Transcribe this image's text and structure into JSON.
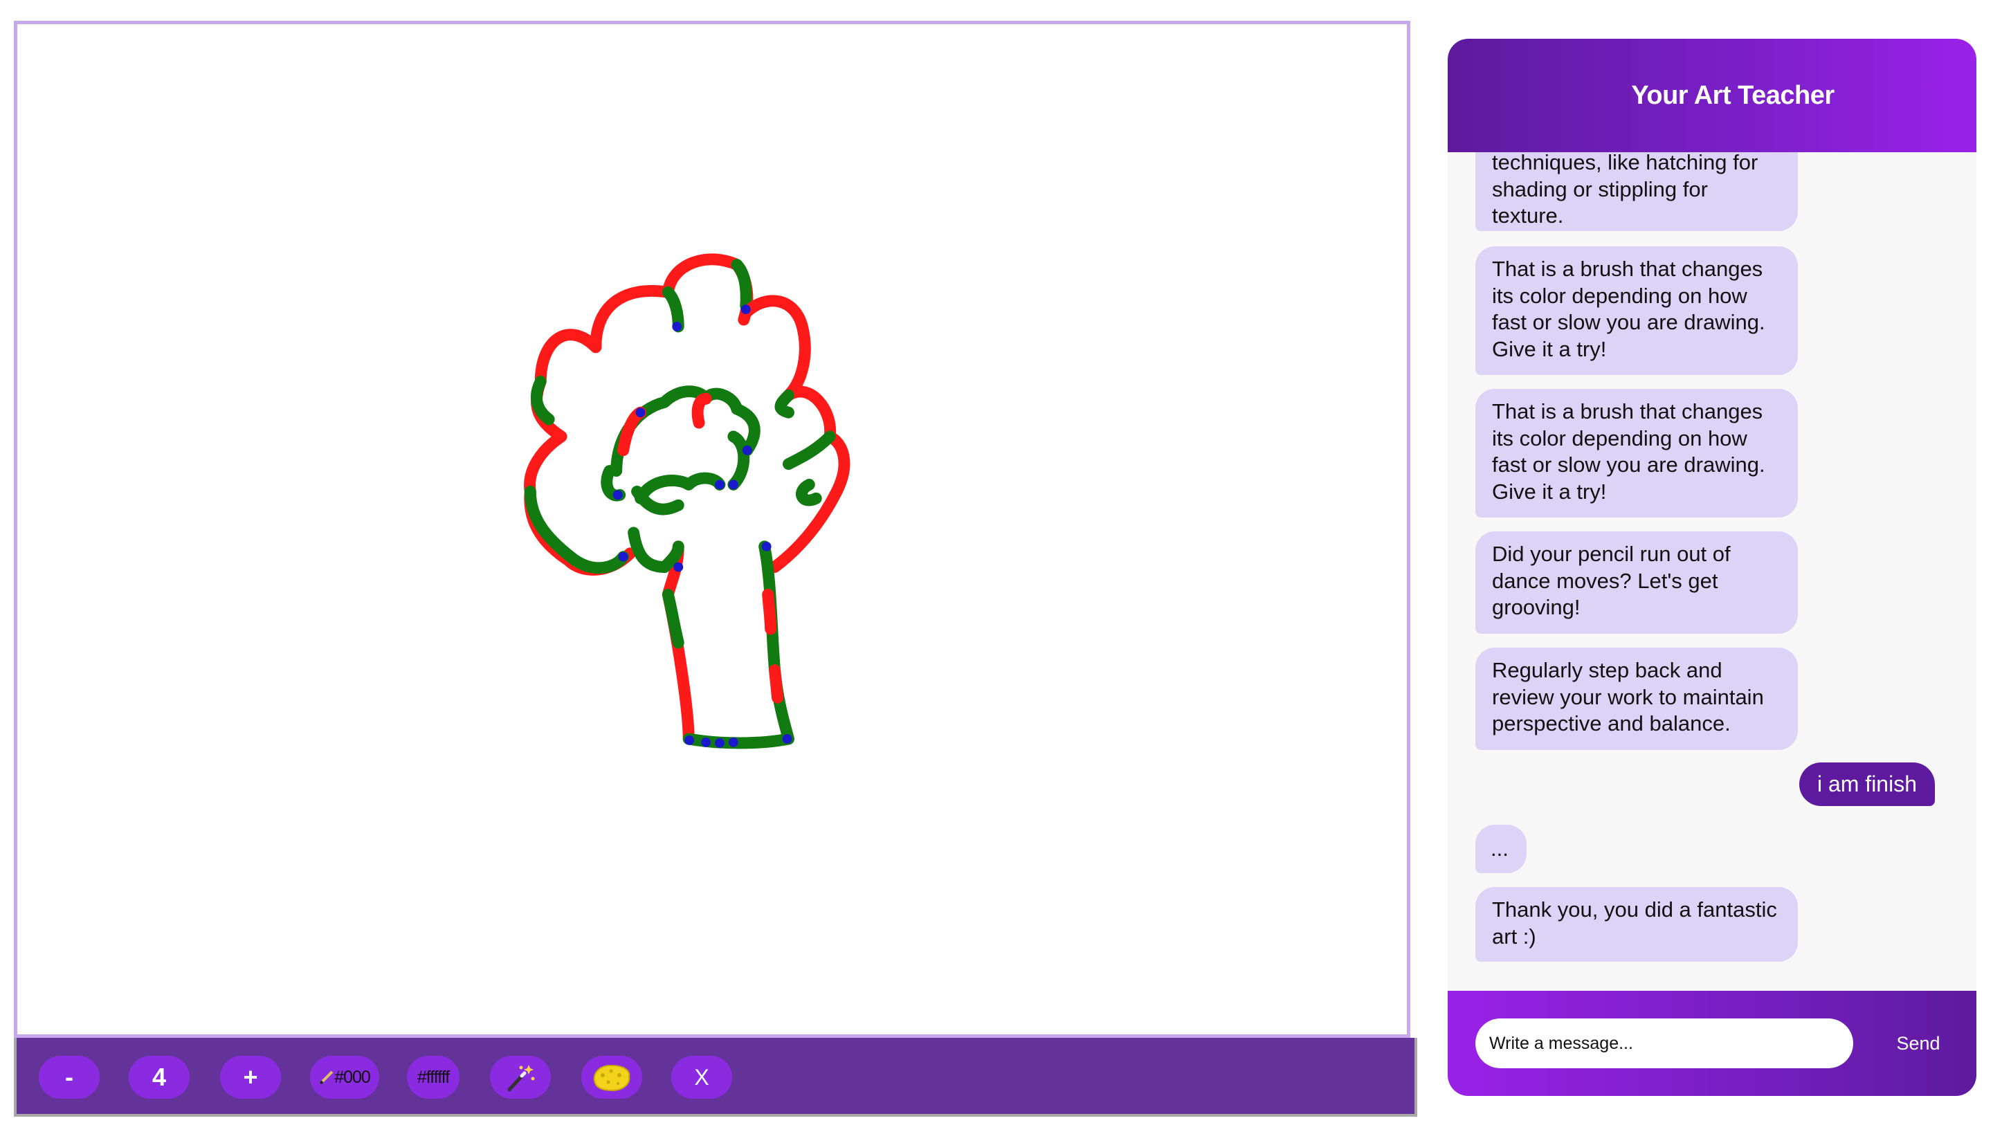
{
  "colors": {
    "toolbar_bg": "#643399",
    "button_bg": "#8a2be2",
    "canvas_border": "#c8a8ec",
    "bot_bubble": "#ddd3f7",
    "user_bubble": "#5e1a9e",
    "stroke_red": "#ff1a1a",
    "stroke_green": "#117a11",
    "stroke_blue": "#1a1acc"
  },
  "toolbar": {
    "decrease_label": "-",
    "brush_size": "4",
    "increase_label": "+",
    "stroke_color_label": "#000",
    "stroke_color_icon": "pencil-icon",
    "background_color_label": "#ffffff",
    "magic_brush_icon": "magic-wand-icon",
    "eraser_icon": "sponge-icon",
    "clear_label": "X"
  },
  "chat": {
    "title": "Your Art Teacher",
    "messages": [
      {
        "from": "bot",
        "text": "techniques, like hatching for shading or stippling for texture."
      },
      {
        "from": "bot",
        "text": "That is a brush that changes its color depending on how fast or slow you are drawing. Give it a try!"
      },
      {
        "from": "bot",
        "text": "That is a brush that changes its color depending on how fast or slow you are drawing. Give it a try!"
      },
      {
        "from": "bot",
        "text": "Did your pencil run out of dance moves? Let's get grooving!"
      },
      {
        "from": "bot",
        "text": "Regularly step back and review your work to maintain perspective and balance."
      },
      {
        "from": "user",
        "text": "i am finish"
      },
      {
        "from": "bot",
        "text": "..."
      },
      {
        "from": "bot",
        "text": "Thank you, you did a fantastic art :)"
      }
    ],
    "input_placeholder": "Write a message...",
    "send_label": "Send"
  }
}
